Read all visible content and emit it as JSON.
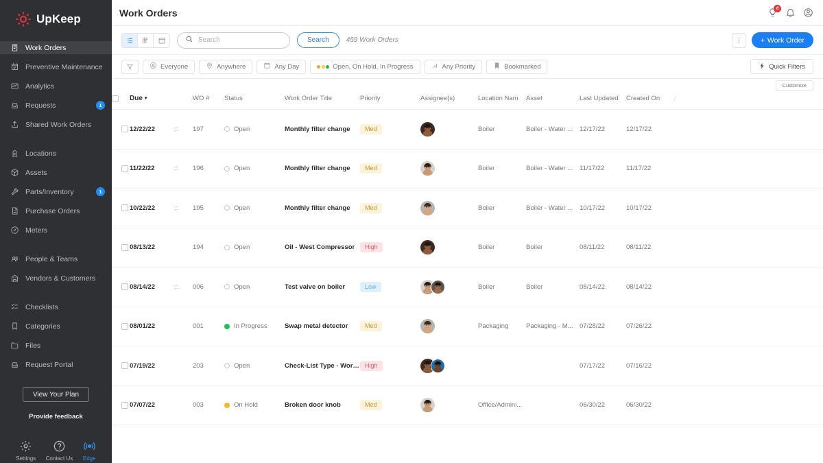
{
  "brand": {
    "name": "UpKeep"
  },
  "sidebar": {
    "groups": [
      {
        "items": [
          {
            "label": "Work Orders",
            "icon": "clipboard-icon",
            "active": true,
            "badge": null
          },
          {
            "label": "Preventive Maintenance",
            "icon": "calendar-check-icon",
            "active": false,
            "badge": null
          },
          {
            "label": "Analytics",
            "icon": "chart-icon",
            "active": false,
            "badge": null
          },
          {
            "label": "Requests",
            "icon": "inbox-icon",
            "active": false,
            "badge": "1"
          },
          {
            "label": "Shared Work Orders",
            "icon": "share-icon",
            "active": false,
            "badge": null
          }
        ]
      },
      {
        "items": [
          {
            "label": "Locations",
            "icon": "location-icon",
            "active": false,
            "badge": null
          },
          {
            "label": "Assets",
            "icon": "cube-icon",
            "active": false,
            "badge": null
          },
          {
            "label": "Parts/Inventory",
            "icon": "wrench-icon",
            "active": false,
            "badge": "1"
          },
          {
            "label": "Purchase Orders",
            "icon": "document-icon",
            "active": false,
            "badge": null
          },
          {
            "label": "Meters",
            "icon": "meter-icon",
            "active": false,
            "badge": null
          }
        ]
      },
      {
        "items": [
          {
            "label": "People & Teams",
            "icon": "people-icon",
            "active": false,
            "badge": null
          },
          {
            "label": "Vendors & Customers",
            "icon": "building-icon",
            "active": false,
            "badge": null
          }
        ]
      },
      {
        "items": [
          {
            "label": "Checklists",
            "icon": "checklist-icon",
            "active": false,
            "badge": null
          },
          {
            "label": "Categories",
            "icon": "bookmark-icon",
            "active": false,
            "badge": null
          },
          {
            "label": "Files",
            "icon": "folder-icon",
            "active": false,
            "badge": null
          },
          {
            "label": "Request Portal",
            "icon": "portal-icon",
            "active": false,
            "badge": null
          }
        ]
      }
    ],
    "footer": {
      "plan_button": "View Your Plan",
      "feedback": "Provide feedback",
      "tools": [
        {
          "label": "Settings",
          "icon": "gear-icon"
        },
        {
          "label": "Contact Us",
          "icon": "question-icon"
        },
        {
          "label": "Edge",
          "icon": "signal-icon"
        }
      ]
    }
  },
  "header": {
    "title": "Work Orders",
    "icons": [
      {
        "name": "lightbulb-icon",
        "badge": "6"
      },
      {
        "name": "bell-icon",
        "badge": null
      },
      {
        "name": "profile-icon",
        "badge": null
      }
    ]
  },
  "toolbar": {
    "views": [
      {
        "name": "list-view",
        "active": true
      },
      {
        "name": "board-view",
        "active": false
      },
      {
        "name": "calendar-view",
        "active": false
      }
    ],
    "search_placeholder": "Search",
    "search_value": "",
    "search_button": "Search",
    "count_text": "459 Work Orders",
    "kebab": "more-options",
    "new_button": "Work Order",
    "new_button_prefix": "+"
  },
  "filters": {
    "chips": [
      {
        "label": "Everyone",
        "icon": "person-circle-icon"
      },
      {
        "label": "Anywhere",
        "icon": "pin-icon"
      },
      {
        "label": "Any Day",
        "icon": "calendar-icon"
      },
      {
        "label": "Open, On Hold, In Progress",
        "icon": "status-dots-icon"
      },
      {
        "label": "Any Priority",
        "icon": "bars-icon"
      },
      {
        "label": "Bookmarked",
        "icon": "bookmark-icon"
      }
    ],
    "quick_filters": "Quick Filters",
    "customize": "Customize"
  },
  "table": {
    "columns": [
      "Due",
      "WO #",
      "Status",
      "Work Order Title",
      "Priority",
      "Assignee(s)",
      "Location Nam",
      "Asset",
      "Last Updated",
      "Created On"
    ],
    "sort_column": "Due",
    "rows": [
      {
        "due": "12/22/22",
        "recurring": true,
        "wo": "197",
        "status": "Open",
        "status_type": "open",
        "title": "Monthly filter change",
        "priority": "Med",
        "assignees": 1,
        "location": "Boiler",
        "asset": "Boiler - Water ...",
        "updated": "12/17/22",
        "created": "12/17/22"
      },
      {
        "due": "11/22/22",
        "recurring": true,
        "wo": "196",
        "status": "Open",
        "status_type": "open",
        "title": "Monthly filter change",
        "priority": "Med",
        "assignees": 1,
        "location": "Boiler",
        "asset": "Boiler - Water ...",
        "updated": "11/17/22",
        "created": "11/17/22"
      },
      {
        "due": "10/22/22",
        "recurring": true,
        "wo": "195",
        "status": "Open",
        "status_type": "open",
        "title": "Monthly filter change",
        "priority": "Med",
        "assignees": 1,
        "location": "Boiler",
        "asset": "Boiler - Water ...",
        "updated": "10/17/22",
        "created": "10/17/22"
      },
      {
        "due": "08/13/22",
        "recurring": false,
        "wo": "194",
        "status": "Open",
        "status_type": "open",
        "title": "Oil - West Compressor",
        "priority": "High",
        "assignees": 1,
        "location": "Boiler",
        "asset": "Boiler",
        "updated": "08/11/22",
        "created": "08/11/22"
      },
      {
        "due": "08/14/22",
        "recurring": true,
        "wo": "006",
        "status": "Open",
        "status_type": "open",
        "title": "Test valve on boiler",
        "priority": "Low",
        "assignees": 2,
        "location": "Boiler",
        "asset": "Boiler",
        "updated": "08/14/22",
        "created": "08/14/22"
      },
      {
        "due": "08/01/22",
        "recurring": false,
        "wo": "001",
        "status": "In Progress",
        "status_type": "prog",
        "title": "Swap metal detector",
        "priority": "Med",
        "assignees": 1,
        "location": "Packaging",
        "asset": "Packaging - M...",
        "updated": "07/28/22",
        "created": "07/26/22"
      },
      {
        "due": "07/19/22",
        "recurring": false,
        "wo": "203",
        "status": "Open",
        "status_type": "open",
        "title": "Check-List Type - Work Or...",
        "priority": "High",
        "assignees": 2,
        "location": "",
        "asset": "",
        "updated": "07/17/22",
        "created": "07/16/22"
      },
      {
        "due": "07/07/22",
        "recurring": false,
        "wo": "003",
        "status": "On Hold",
        "status_type": "hold",
        "title": "Broken door knob",
        "priority": "Med",
        "assignees": 1,
        "location": "Office/Admini...",
        "asset": "",
        "updated": "06/30/22",
        "created": "06/30/22"
      }
    ]
  },
  "colors": {
    "sidebar_bg": "#2f3033",
    "accent_blue": "#1a7ef5",
    "badge_blue": "#1f8cf5",
    "badge_red": "#e8323c",
    "status_open": "#c5c9ce",
    "status_in_progress": "#21c05a",
    "status_on_hold": "#f5b820",
    "priority_med": "#c9973a",
    "priority_high": "#e0636f",
    "priority_low": "#6aaed6",
    "brand_red": "#e8323c"
  }
}
